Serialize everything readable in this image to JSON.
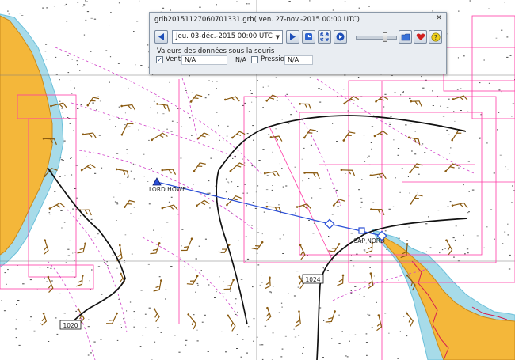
{
  "grib_panel": {
    "title": "grib20151127060701331.grb( ven. 27-nov.-2015 00:00  UTC)",
    "date_selected": "Jeu. 03-déc.-2015 00:00  UTC",
    "section_label": "Valeurs des données sous la souris",
    "wind": {
      "label": "Vent",
      "checked": true,
      "value1": "N/A",
      "value2": "N/A"
    },
    "pressure": {
      "label": "Pression",
      "checked": false,
      "value": "N/A"
    },
    "time_slider_fraction": 0.75
  },
  "map": {
    "waypoint_labels": [
      "LORD HOWE",
      "CAP NORD"
    ],
    "isobar_labels": [
      "1024",
      "1020"
    ]
  },
  "colors": {
    "land": "#f4b73a",
    "shallow_water": "#a7dbe9",
    "route": "#2b4fd6",
    "chart_lines": "#ff3aa6",
    "wind_barbs": "#8a5a10"
  }
}
